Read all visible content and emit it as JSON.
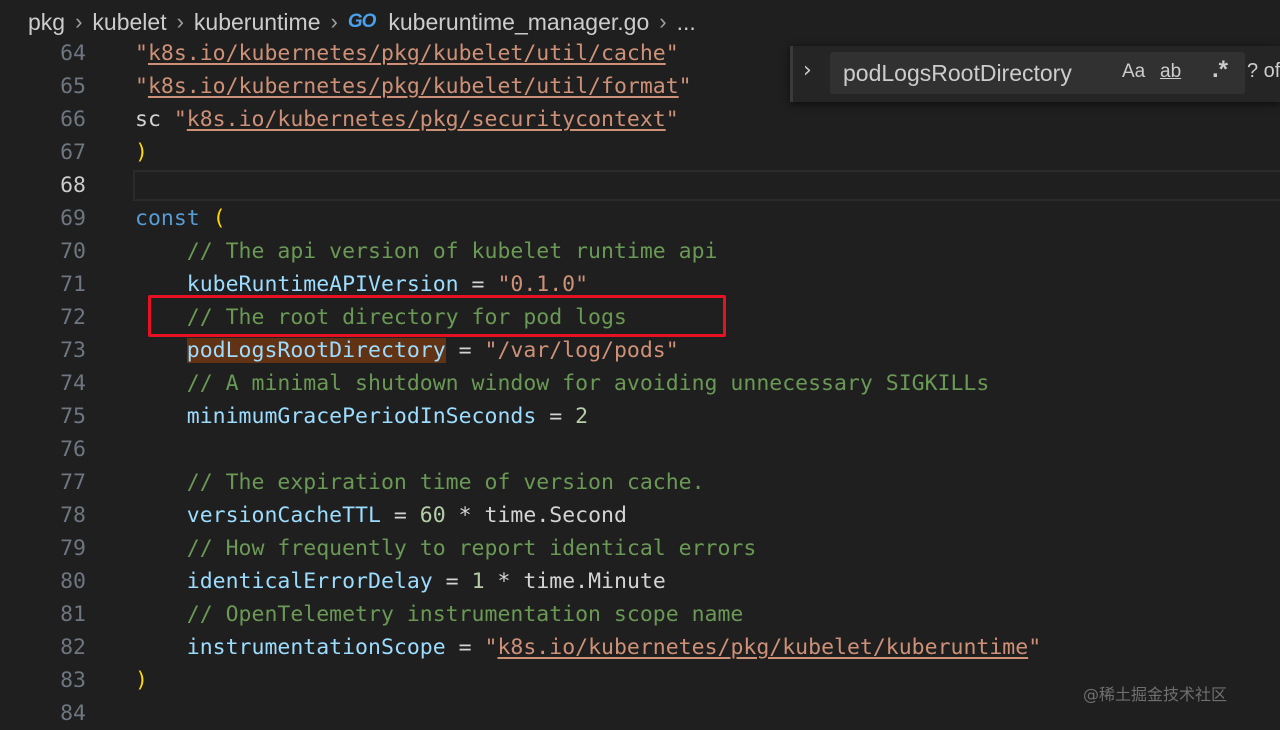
{
  "breadcrumb": {
    "items": [
      "pkg",
      "kubelet",
      "kuberuntime"
    ],
    "file": "kuberuntime_manager.go",
    "file_icon": "GO",
    "more": "..."
  },
  "editor": {
    "lines": [
      {
        "n": "64",
        "tokens": [
          [
            "\"",
            "str"
          ],
          [
            "k8s.io/kubernetes/pkg/kubelet/util/cache",
            "str link"
          ],
          [
            "\"",
            "str"
          ]
        ]
      },
      {
        "n": "65",
        "tokens": [
          [
            "\"",
            "str"
          ],
          [
            "k8s.io/kubernetes/pkg/kubelet/util/format",
            "str link"
          ],
          [
            "\"",
            "str"
          ]
        ]
      },
      {
        "n": "66",
        "tokens": [
          [
            "sc ",
            "id"
          ],
          [
            "\"",
            "str"
          ],
          [
            "k8s.io/kubernetes/pkg/securitycontext",
            "str link"
          ],
          [
            "\"",
            "str"
          ]
        ]
      },
      {
        "n": "67",
        "tokens": [
          [
            ")",
            "br"
          ]
        ]
      },
      {
        "n": "68",
        "tokens": [],
        "active": true
      },
      {
        "n": "69",
        "tokens": [
          [
            "const",
            "kw"
          ],
          [
            " ",
            "id"
          ],
          [
            "(",
            "br"
          ]
        ]
      },
      {
        "n": "70",
        "tokens": [
          [
            "    ",
            "id"
          ],
          [
            "// The api version of kubelet runtime api",
            "cm"
          ]
        ]
      },
      {
        "n": "71",
        "tokens": [
          [
            "    ",
            "id"
          ],
          [
            "kubeRuntimeAPIVersion",
            "var"
          ],
          [
            " = ",
            "op"
          ],
          [
            "\"0.1.0\"",
            "str"
          ]
        ]
      },
      {
        "n": "72",
        "tokens": [
          [
            "    ",
            "id"
          ],
          [
            "// The root directory for pod logs",
            "cm"
          ]
        ]
      },
      {
        "n": "73",
        "tokens": [
          [
            "    ",
            "id"
          ],
          [
            "podLogsRootDirectory",
            "var hl"
          ],
          [
            " = ",
            "op"
          ],
          [
            "\"/var/log/pods\"",
            "str"
          ]
        ]
      },
      {
        "n": "74",
        "tokens": [
          [
            "    ",
            "id"
          ],
          [
            "// A minimal shutdown window for avoiding unnecessary SIGKILLs",
            "cm"
          ]
        ]
      },
      {
        "n": "75",
        "tokens": [
          [
            "    ",
            "id"
          ],
          [
            "minimumGracePeriodInSeconds",
            "var"
          ],
          [
            " = ",
            "op"
          ],
          [
            "2",
            "num"
          ]
        ]
      },
      {
        "n": "76",
        "tokens": []
      },
      {
        "n": "77",
        "tokens": [
          [
            "    ",
            "id"
          ],
          [
            "// The expiration time of version cache.",
            "cm"
          ]
        ]
      },
      {
        "n": "78",
        "tokens": [
          [
            "    ",
            "id"
          ],
          [
            "versionCacheTTL",
            "var"
          ],
          [
            " = ",
            "op"
          ],
          [
            "60",
            "num"
          ],
          [
            " * ",
            "op"
          ],
          [
            "time",
            "id"
          ],
          [
            ".",
            "op"
          ],
          [
            "Second",
            "id"
          ]
        ]
      },
      {
        "n": "79",
        "tokens": [
          [
            "    ",
            "id"
          ],
          [
            "// How frequently to report identical errors",
            "cm"
          ]
        ]
      },
      {
        "n": "80",
        "tokens": [
          [
            "    ",
            "id"
          ],
          [
            "identicalErrorDelay",
            "var"
          ],
          [
            " = ",
            "op"
          ],
          [
            "1",
            "num"
          ],
          [
            " * ",
            "op"
          ],
          [
            "time",
            "id"
          ],
          [
            ".",
            "op"
          ],
          [
            "Minute",
            "id"
          ]
        ]
      },
      {
        "n": "81",
        "tokens": [
          [
            "    ",
            "id"
          ],
          [
            "// OpenTelemetry instrumentation scope name",
            "cm"
          ]
        ]
      },
      {
        "n": "82",
        "tokens": [
          [
            "    ",
            "id"
          ],
          [
            "instrumentationScope",
            "var"
          ],
          [
            " = ",
            "op"
          ],
          [
            "\"",
            "str"
          ],
          [
            "k8s.io/kubernetes/pkg/kubelet/kuberuntime",
            "str link"
          ],
          [
            "\"",
            "str"
          ]
        ]
      },
      {
        "n": "83",
        "tokens": [
          [
            ")",
            "br"
          ]
        ]
      },
      {
        "n": "84",
        "tokens": []
      }
    ]
  },
  "find": {
    "toggle": "›",
    "query": "podLogsRootDirectory",
    "match_case": "Aa",
    "whole_word": "ab",
    "regex": ".*",
    "count": "? of"
  },
  "watermark": "@稀土掘金技术社区"
}
